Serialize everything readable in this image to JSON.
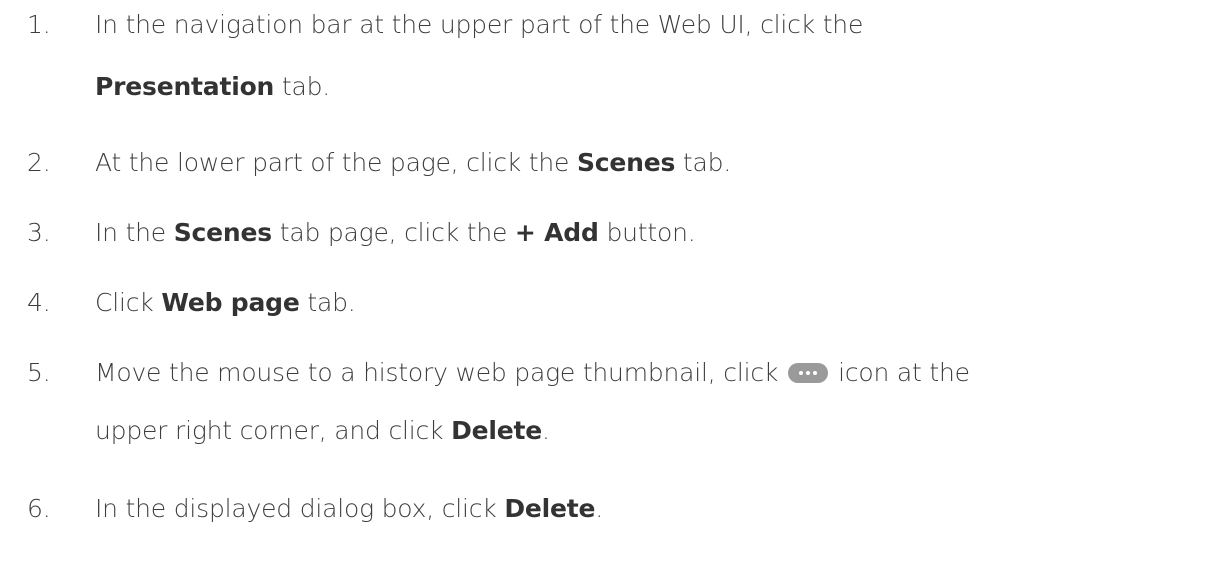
{
  "steps": [
    {
      "number": "1.",
      "line1": "In the navigation bar at the upper part of the Web UI, click the",
      "bold": "Presentation",
      "after": " tab."
    },
    {
      "number": "2.",
      "pre": "At the lower part of the page, click the ",
      "bold": "Scenes",
      "after": " tab."
    },
    {
      "number": "3.",
      "pre": "In the ",
      "bold1": "Scenes",
      "mid": " tab page, click the ",
      "bold2": "+ Add",
      "after": " button."
    },
    {
      "number": "4.",
      "pre": "Click ",
      "bold": "Web page",
      "after": " tab."
    },
    {
      "number": "5.",
      "pre": "Move the mouse to a history web page thumbnail, click",
      "icon": "more-icon",
      "mid": "icon at the",
      "line2_pre": "upper right corner, and click ",
      "bold": "Delete",
      "after": "."
    },
    {
      "number": "6.",
      "pre": "In the displayed dialog box, click ",
      "bold": "Delete",
      "after": "."
    }
  ]
}
